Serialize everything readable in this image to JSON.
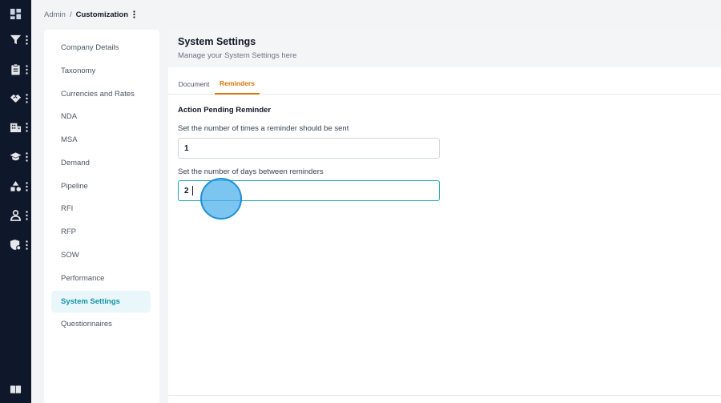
{
  "breadcrumb": {
    "root": "Admin",
    "separator": "/",
    "current": "Customization"
  },
  "icons": {
    "leftbar": [
      "dashboard-icon",
      "filter-icon",
      "clipboard-icon",
      "handshake-icon",
      "building-icon",
      "graduation-cap-icon",
      "shapes-icon",
      "user-icon",
      "shield-settings-icon",
      "book-icon"
    ],
    "kebab": "kebab-menu-icon"
  },
  "subnav": {
    "items": [
      {
        "label": "Company Details"
      },
      {
        "label": "Taxonomy"
      },
      {
        "label": "Currencies and Rates"
      },
      {
        "label": "NDA"
      },
      {
        "label": "MSA"
      },
      {
        "label": "Demand"
      },
      {
        "label": "Pipeline"
      },
      {
        "label": "RFI"
      },
      {
        "label": "RFP"
      },
      {
        "label": "SOW"
      },
      {
        "label": "Performance"
      },
      {
        "label": "System Settings",
        "active": true
      },
      {
        "label": "Questionnaires"
      }
    ]
  },
  "page": {
    "title": "System Settings",
    "subtitle": "Manage your System Settings here"
  },
  "tabs": [
    {
      "label": "Document"
    },
    {
      "label": "Reminders",
      "active": true
    }
  ],
  "reminders": {
    "section_title": "Action Pending Reminder",
    "times_label": "Set the number of times a reminder should be sent",
    "times_value": "1",
    "days_label": "Set the number of days between reminders",
    "days_value": "2"
  },
  "colors": {
    "sidebar_bg": "#0f172a",
    "active_nav_bg": "#e9f7fa",
    "active_nav_text": "#1593a8",
    "active_tab": "#d97706",
    "focus_border": "#1ba3b8"
  }
}
